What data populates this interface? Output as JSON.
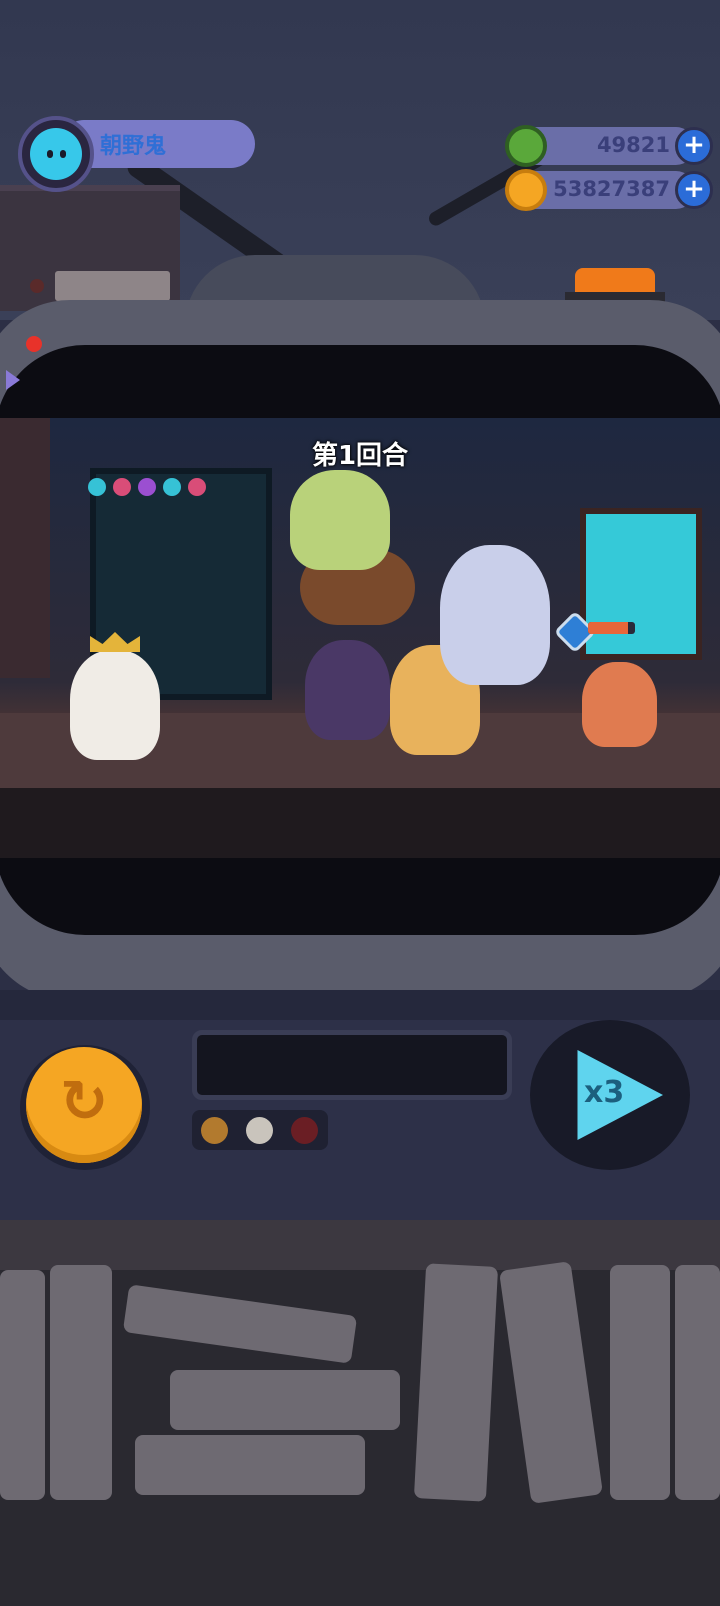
{
  "player": {
    "name": "朝野鬼"
  },
  "currency": {
    "donut": {
      "value": "49821",
      "icon": "donut-icon",
      "color": "#5aa83a"
    },
    "planet": {
      "value": "53827387",
      "icon": "planet-coin-icon",
      "color": "#f5a623"
    }
  },
  "battle": {
    "round_label": "第1回合"
  },
  "enemy": {
    "hp_fraction": 0.85
  },
  "controls": {
    "speed_label": "x3",
    "replay_icon": "replay-icon",
    "indicator_lights": [
      "#b27a2e",
      "#c9c4bc",
      "#6a1e24"
    ]
  }
}
